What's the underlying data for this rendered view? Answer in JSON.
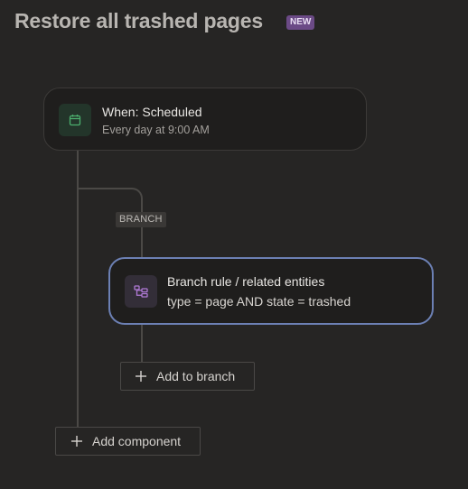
{
  "header": {
    "title": "Restore all trashed pages",
    "badge": "NEW"
  },
  "trigger": {
    "title": "When: Scheduled",
    "subtitle": "Every day at 9:00 AM",
    "icon": "calendar-icon",
    "icon_color": "#4caf6e"
  },
  "branch": {
    "tag": "BRANCH",
    "card": {
      "title": "Branch rule / related entities",
      "subtitle": "type = page AND state = trashed",
      "icon": "branch-icon",
      "icon_color": "#b07ad6"
    },
    "add_label": "Add to branch"
  },
  "footer": {
    "add_component_label": "Add component"
  },
  "colors": {
    "background": "#262524",
    "selected_border": "#6c80b4",
    "badge_bg": "#6b4a86"
  }
}
